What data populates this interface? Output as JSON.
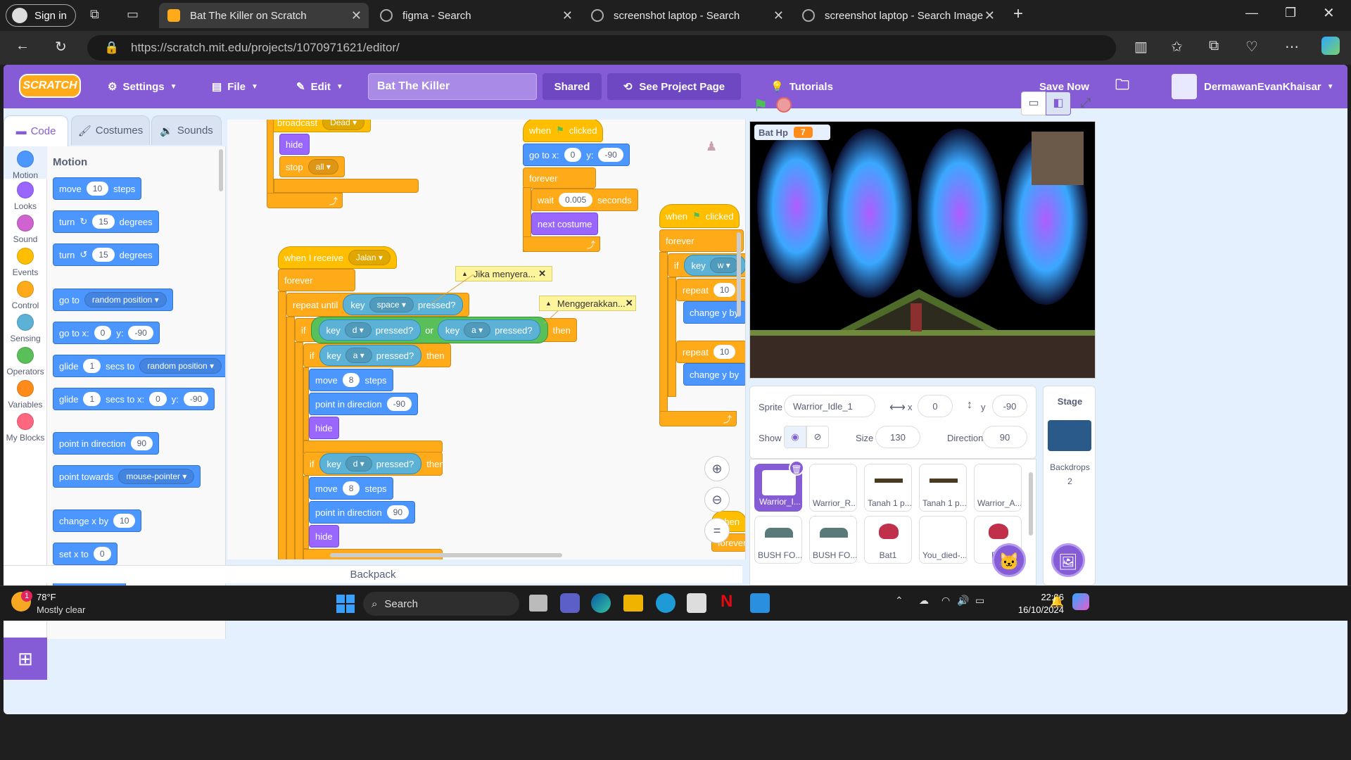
{
  "browser": {
    "signin": "Sign in",
    "tabs": [
      {
        "title": "Bat The Killer on Scratch",
        "active": true
      },
      {
        "title": "figma - Search",
        "active": false
      },
      {
        "title": "screenshot laptop - Search",
        "active": false
      },
      {
        "title": "screenshot laptop - Search Image",
        "active": false
      }
    ],
    "url": "https://scratch.mit.edu/projects/1070971621/editor/"
  },
  "menu": {
    "logo": "SCRATCH",
    "settings": "Settings",
    "file": "File",
    "edit": "Edit",
    "project_title": "Bat The Killer",
    "shared": "Shared",
    "see_project_page": "See Project Page",
    "tutorials": "Tutorials",
    "save_now": "Save Now",
    "username": "DermawanEvanKhaisar"
  },
  "editor_tabs": {
    "code": "Code",
    "costumes": "Costumes",
    "sounds": "Sounds"
  },
  "categories": [
    {
      "label": "Motion",
      "color": "#4c97ff"
    },
    {
      "label": "Looks",
      "color": "#9966ff"
    },
    {
      "label": "Sound",
      "color": "#cf63cf"
    },
    {
      "label": "Events",
      "color": "#ffbf00"
    },
    {
      "label": "Control",
      "color": "#ffab19"
    },
    {
      "label": "Sensing",
      "color": "#5cb1d6"
    },
    {
      "label": "Operators",
      "color": "#59c059"
    },
    {
      "label": "Variables",
      "color": "#ff8c1a"
    },
    {
      "label": "My Blocks",
      "color": "#ff6680"
    }
  ],
  "palette": {
    "heading": "Motion",
    "move": {
      "a": "move",
      "n": "10",
      "b": "steps"
    },
    "turn_right": {
      "a": "turn",
      "n": "15",
      "b": "degrees"
    },
    "turn_left": {
      "a": "turn",
      "n": "15",
      "b": "degrees"
    },
    "goto": {
      "a": "go to",
      "d": "random position"
    },
    "gotoxy": {
      "a": "go to x:",
      "x": "0",
      "b": "y:",
      "y": "-90"
    },
    "glide": {
      "a": "glide",
      "n": "1",
      "b": "secs to",
      "d": "random position"
    },
    "glidexy": {
      "a": "glide",
      "n": "1",
      "b": "secs to x:",
      "x": "0",
      "c": "y:",
      "y": "-90"
    },
    "point": {
      "a": "point in direction",
      "n": "90"
    },
    "towards": {
      "a": "point towards",
      "d": "mouse-pointer"
    },
    "changex": {
      "a": "change x by",
      "n": "10"
    },
    "setx": {
      "a": "set x to",
      "n": "0"
    }
  },
  "scripts": {
    "s1": {
      "broadcast": "broadcast",
      "broadcast_msg": "Dead",
      "hide": "hide",
      "stop": "stop",
      "stop_opt": "all"
    },
    "s2": {
      "hat": "when I receive",
      "msg": "Jalan",
      "forever": "forever",
      "repeat_until": "repeat until",
      "key": "key",
      "space": "space",
      "pressed": "pressed?",
      "if": "if",
      "d": "d",
      "a": "a",
      "or": "or",
      "then": "then",
      "move": "move",
      "steps": "steps",
      "eight": "8",
      "point": "point in direction",
      "neg90": "-90",
      "pos90": "90",
      "hide": "hide"
    },
    "s3": {
      "when": "when",
      "clicked": "clicked",
      "gotox": "go to x:",
      "x": "0",
      "y": "y:",
      "yv": "-90",
      "forever": "forever",
      "wait": "wait",
      "secs": "0.005",
      "seconds": "seconds",
      "next": "next costume"
    },
    "s4": {
      "when": "when",
      "clicked": "clicked",
      "forever": "forever",
      "if": "if",
      "key": "key",
      "w": "w",
      "repeat": "repeat",
      "ten": "10",
      "changey": "change y by"
    },
    "comment1": "Jika menyera...",
    "comment2": "Menggerakkan...",
    "s5": {
      "when": "when",
      "forever": "forever"
    }
  },
  "backpack": "Backpack",
  "stage": {
    "monitor_label": "Bat Hp",
    "monitor_value": "7"
  },
  "sprite_info": {
    "sprite_label": "Sprite",
    "sprite_name": "Warrior_Idle_1",
    "x_label": "x",
    "x": "0",
    "y_label": "y",
    "y": "-90",
    "show_label": "Show",
    "size_label": "Size",
    "size": "130",
    "direction_label": "Direction",
    "direction": "90"
  },
  "sprites": [
    "Warrior_I...",
    "Warrior_R...",
    "Tanah 1 p...",
    "Tanah 1 p...",
    "Warrior_A...",
    "BUSH FO...",
    "BUSH FO...",
    "Bat1",
    "You_died-...",
    "B..."
  ],
  "stage_panel": {
    "title": "Stage",
    "backdrops_label": "Backdrops",
    "backdrops_count": "2"
  },
  "taskbar": {
    "temp": "78°F",
    "weather": "Mostly clear",
    "search": "Search",
    "time": "22:06",
    "date": "16/10/2024",
    "badge": "1"
  }
}
